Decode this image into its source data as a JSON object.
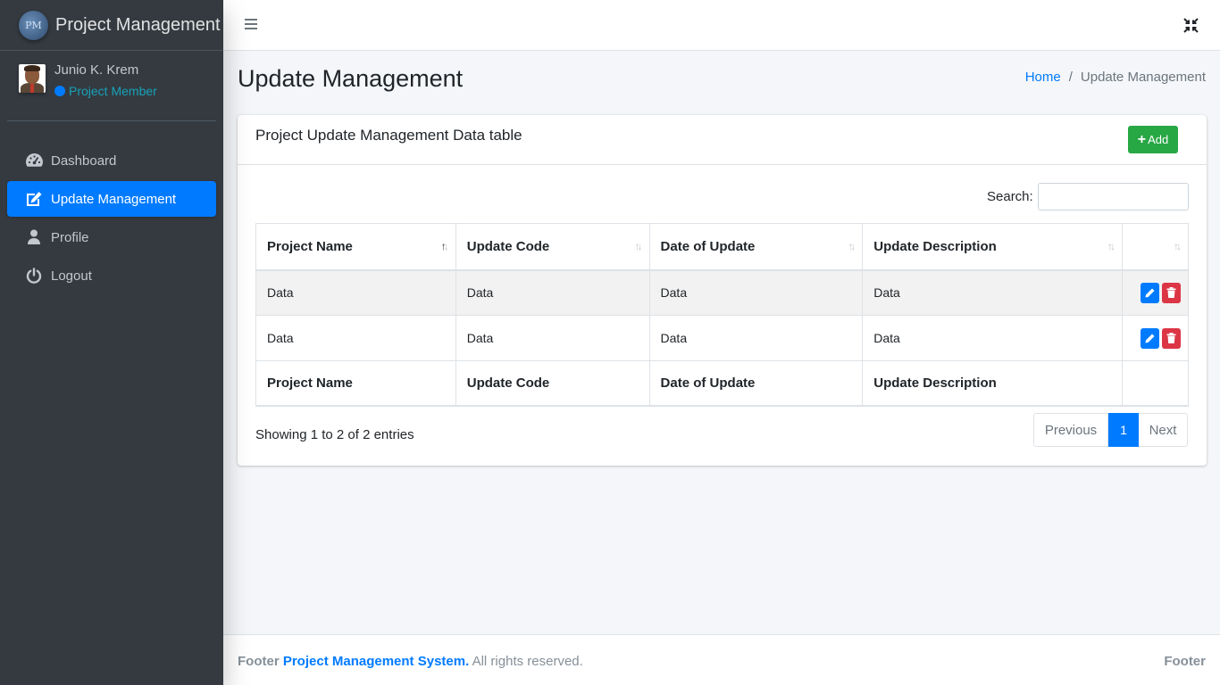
{
  "brand": {
    "title": "Project Management",
    "logo_text": "PM"
  },
  "user": {
    "name": "Junio K. Krem",
    "role": "Project Member"
  },
  "sidebar": {
    "items": [
      {
        "label": "Dashboard",
        "icon": "tachometer-icon",
        "active": false
      },
      {
        "label": "Update Management",
        "icon": "edit-icon",
        "active": true
      },
      {
        "label": "Profile",
        "icon": "user-icon",
        "active": false
      },
      {
        "label": "Logout",
        "icon": "power-icon",
        "active": false
      }
    ]
  },
  "page": {
    "title": "Update Management"
  },
  "breadcrumb": {
    "home": "Home",
    "separator": "/",
    "current": "Update Management"
  },
  "card": {
    "title": "Project Update Management Data table",
    "add_label": "Add"
  },
  "search": {
    "label": "Search:",
    "value": ""
  },
  "table": {
    "columns": [
      "Project Name",
      "Update Code",
      "Date of Update",
      "Update Description"
    ],
    "rows": [
      [
        "Data",
        "Data",
        "Data",
        "Data"
      ],
      [
        "Data",
        "Data",
        "Data",
        "Data"
      ]
    ],
    "sorted_column": "Project Name",
    "sort_direction": "ascending"
  },
  "pagination": {
    "info": "Showing 1 to 2 of 2 entries",
    "previous": "Previous",
    "current_page": "1",
    "next": "Next"
  },
  "footer": {
    "prefix": "Footer",
    "link": "Project Management System.",
    "suffix": "All rights reserved.",
    "right": "Footer"
  },
  "colors": {
    "primary": "#007bff",
    "success": "#28a745",
    "danger": "#dc3545",
    "sidebar_bg": "#343a40",
    "role": "#17a2b8"
  }
}
